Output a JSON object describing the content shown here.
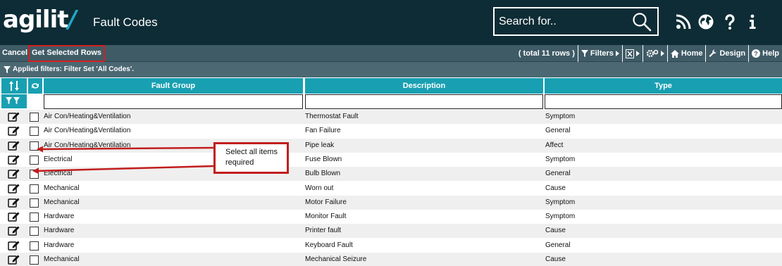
{
  "header": {
    "logo_text": "agilit",
    "logo_slash": "/",
    "app_title": "Fault Codes",
    "search_placeholder": "Search for..",
    "icons": [
      "rss-icon",
      "globe-icon",
      "help-icon",
      "info-icon"
    ]
  },
  "toolbar": {
    "cancel_label": "Cancel",
    "get_selected_label": "Get Selected Rows",
    "total_label": "( total 11 rows )",
    "filters_label": "Filters",
    "home_label": "Home",
    "design_label": "Design",
    "help_label": "Help"
  },
  "filter_bar": {
    "text": "Applied filters: Filter Set 'All Codes'."
  },
  "table": {
    "columns": [
      "Fault Group",
      "Description",
      "Type"
    ],
    "rows": [
      {
        "group": "Air Con/Heating&Ventilation",
        "description": "Thermostat Fault",
        "type": "Symptom"
      },
      {
        "group": "Air Con/Heating&Ventilation",
        "description": "Fan Failure",
        "type": "General"
      },
      {
        "group": "Air Con/Heating&Ventilation",
        "description": "Pipe leak",
        "type": "Affect"
      },
      {
        "group": "Electrical",
        "description": "Fuse Blown",
        "type": "Symptom"
      },
      {
        "group": "Electrical",
        "description": "Bulb Blown",
        "type": "General"
      },
      {
        "group": "Mechanical",
        "description": "Worn out",
        "type": "Cause"
      },
      {
        "group": "Mechanical",
        "description": "Motor Failure",
        "type": "Symptom"
      },
      {
        "group": "Hardware",
        "description": "Monitor Fault",
        "type": "Symptom"
      },
      {
        "group": "Hardware",
        "description": "Printer fault",
        "type": "Cause"
      },
      {
        "group": "Hardware",
        "description": "Keyboard Fault",
        "type": "General"
      },
      {
        "group": "Mechanical",
        "description": "Mechanical Seizure",
        "type": "Cause"
      }
    ]
  },
  "annotation": {
    "line1": "Select all items",
    "line2": "required"
  },
  "colors": {
    "header_bg": "#0e2c35",
    "toolbar_bg": "#3f5b66",
    "filterbar_bg": "#4b6873",
    "column_header_bg": "#18a0b2",
    "highlight_red": "#d21f1f"
  }
}
